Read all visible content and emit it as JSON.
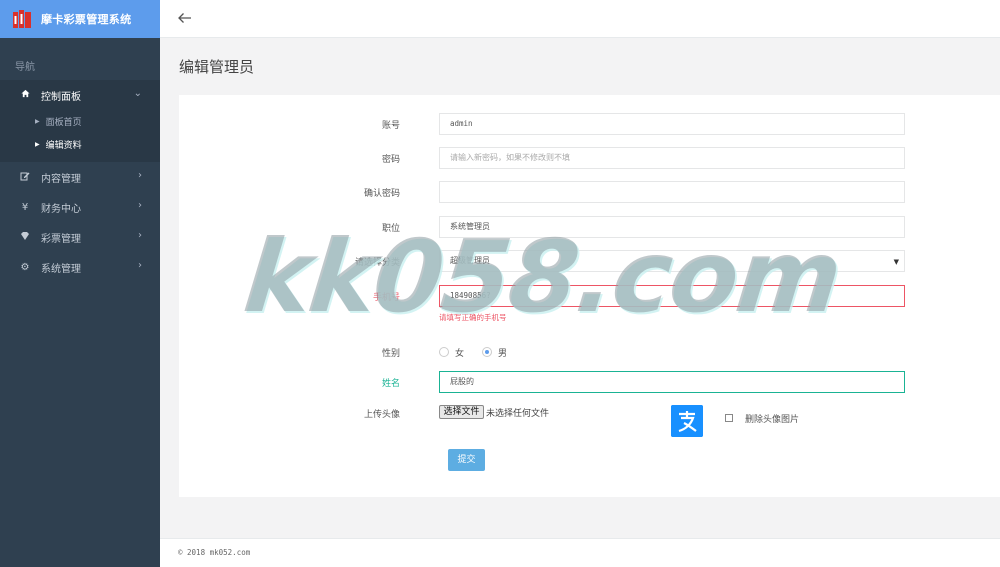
{
  "brand": {
    "title": "摩卡彩票管理系统"
  },
  "sidebar": {
    "header": "导航",
    "items": [
      {
        "label": "控制面板",
        "icon": "home-icon",
        "expanded": true
      },
      {
        "label": "内容管理",
        "icon": "edit-icon"
      },
      {
        "label": "财务中心",
        "icon": "yen-icon"
      },
      {
        "label": "彩票管理",
        "icon": "gem-icon"
      },
      {
        "label": "系统管理",
        "icon": "gear-icon"
      }
    ],
    "sub_items": [
      {
        "label": "面板首页"
      },
      {
        "label": "编辑资料",
        "active": true
      }
    ]
  },
  "page": {
    "title": "编辑管理员"
  },
  "form": {
    "account": {
      "label": "账号",
      "value": "admin"
    },
    "password": {
      "label": "密码",
      "placeholder": "请输入新密码，如果不修改则不填"
    },
    "confirm": {
      "label": "确认密码",
      "value": ""
    },
    "position": {
      "label": "职位",
      "value": "系统管理员"
    },
    "category": {
      "label": "请选择分类",
      "value": "超级管理员"
    },
    "phone": {
      "label": "手机号",
      "value": "18490856?",
      "error": "请填写正确的手机号"
    },
    "gender": {
      "label": "性别",
      "options": [
        "女",
        "男"
      ],
      "selected": "男"
    },
    "name": {
      "label": "姓名",
      "value": "屁股的"
    },
    "avatar": {
      "label": "上传头像",
      "button": "选择文件",
      "status": "未选择任何文件",
      "delete_label": "删除头像图片"
    },
    "submit": "提交"
  },
  "footer": {
    "text": "© 2018 mk052.com"
  },
  "watermark": "kk058.com",
  "colors": {
    "sidebar": "#2f4050",
    "brand": "#5d9cec",
    "error": "#ed5565",
    "success": "#1ab394",
    "submit": "#5dade2"
  }
}
